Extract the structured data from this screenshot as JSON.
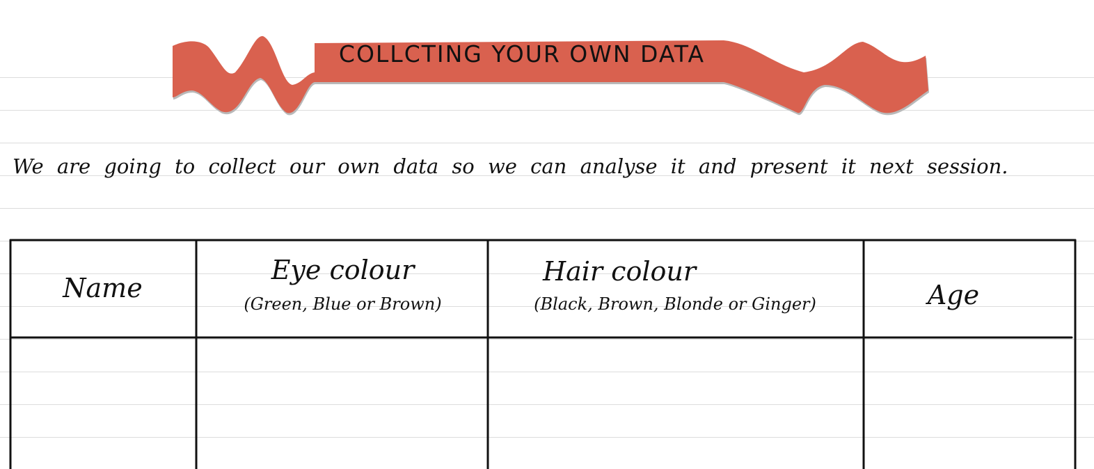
{
  "banner": {
    "title": "COLLCTING YOUR OWN DATA",
    "ribbon_color": "#d9614f",
    "shadow_color": "#b9b9b9"
  },
  "intro": {
    "text": "We are going to collect our own data so we can analyse it and present it next session."
  },
  "paper": {
    "line_color": "#dcdcdc",
    "background": "#ffffff"
  },
  "table": {
    "columns": [
      {
        "label": "Name",
        "sublabel": ""
      },
      {
        "label": "Eye colour",
        "sublabel": "(Green, Blue or Brown)"
      },
      {
        "label": "Hair colour",
        "sublabel": "(Black, Brown, Blonde or Ginger)"
      },
      {
        "label": "Age",
        "sublabel": ""
      }
    ],
    "rows": [
      [
        "",
        "",
        "",
        ""
      ]
    ]
  }
}
